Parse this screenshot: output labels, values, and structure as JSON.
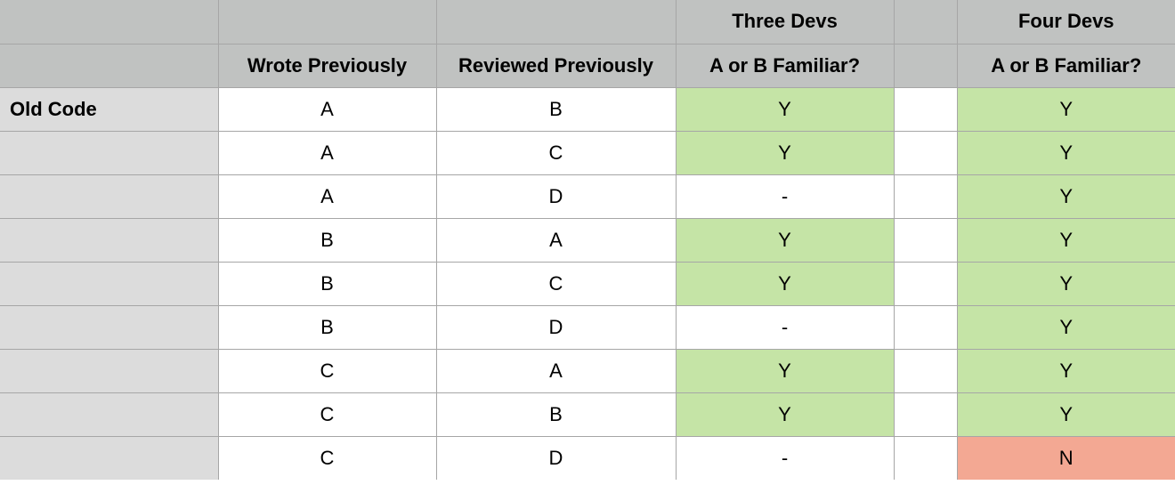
{
  "header": {
    "row1": [
      "",
      "",
      "",
      "Three Devs",
      "",
      "Four Devs"
    ],
    "row2": [
      "",
      "Wrote Previously",
      "Reviewed Previously",
      "A or B Familiar?",
      "",
      "A or B Familiar?"
    ]
  },
  "rows": [
    {
      "label": "Old Code",
      "wrote": "A",
      "reviewed": "B",
      "three": "Y",
      "four": "Y"
    },
    {
      "label": "",
      "wrote": "A",
      "reviewed": "C",
      "three": "Y",
      "four": "Y"
    },
    {
      "label": "",
      "wrote": "A",
      "reviewed": "D",
      "three": "-",
      "four": "Y"
    },
    {
      "label": "",
      "wrote": "B",
      "reviewed": "A",
      "three": "Y",
      "four": "Y"
    },
    {
      "label": "",
      "wrote": "B",
      "reviewed": "C",
      "three": "Y",
      "four": "Y"
    },
    {
      "label": "",
      "wrote": "B",
      "reviewed": "D",
      "three": "-",
      "four": "Y"
    },
    {
      "label": "",
      "wrote": "C",
      "reviewed": "A",
      "three": "Y",
      "four": "Y"
    },
    {
      "label": "",
      "wrote": "C",
      "reviewed": "B",
      "three": "Y",
      "four": "Y"
    },
    {
      "label": "",
      "wrote": "C",
      "reviewed": "D",
      "three": "-",
      "four": "N"
    }
  ],
  "colors": {
    "header_bg": "#c0c2c1",
    "label_bg": "#dcdcdc",
    "yes_bg": "#c5e4a6",
    "no_bg": "#f3a893",
    "grid": "#a6a6a6"
  }
}
